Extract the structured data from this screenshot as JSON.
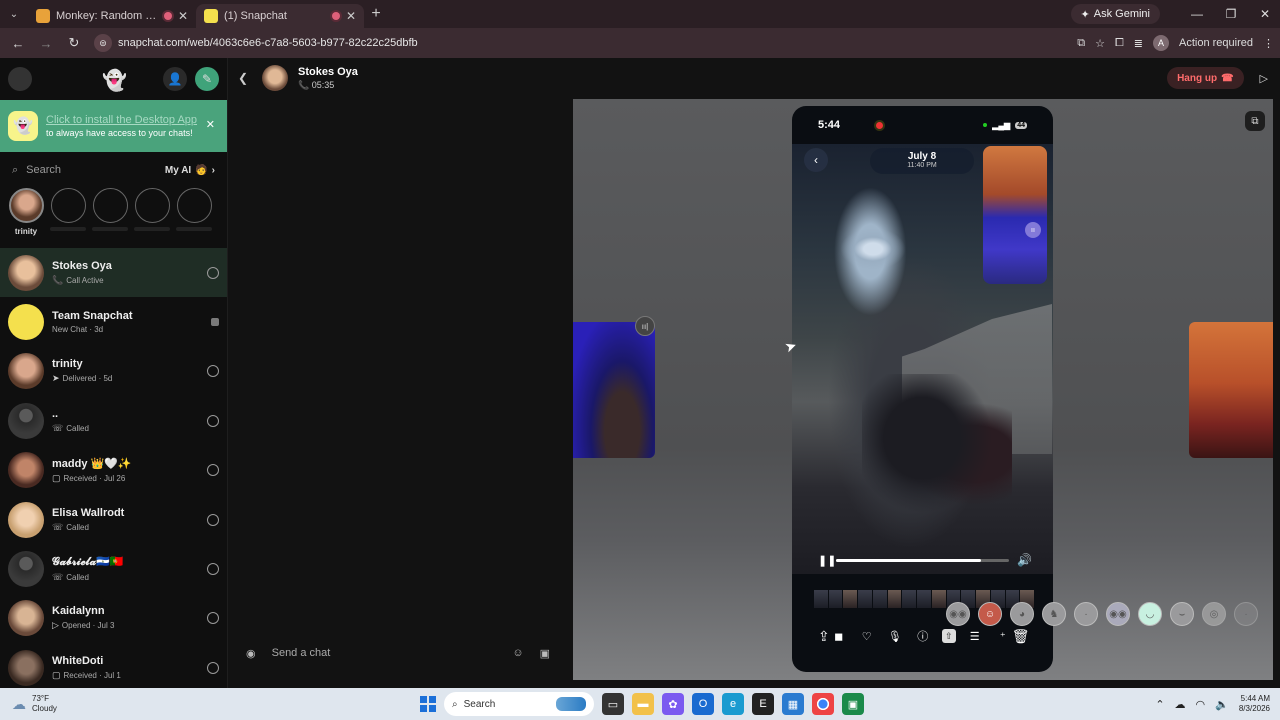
{
  "browser": {
    "tabs": [
      {
        "title": "Monkey: Random Video Ch",
        "fav_color": "#e8a23a",
        "active": false
      },
      {
        "title": "(1) Snapchat",
        "fav_color": "#f4e04d",
        "active": true
      }
    ],
    "ask_gemini": "Ask Gemini",
    "url": "snapchat.com/web/4063c6e6-c7a8-5603-b977-82c22c25dbfb",
    "action_required": "Action required",
    "profile_initial": "A"
  },
  "sidebar": {
    "install": {
      "title": "Click to install the Desktop App",
      "subtitle": "to always have access to your chats!"
    },
    "search_placeholder": "Search",
    "my_ai": "My AI",
    "stories": [
      {
        "name": "trinity",
        "has_image": true
      },
      {
        "name": "",
        "has_image": false
      },
      {
        "name": "",
        "has_image": false
      },
      {
        "name": "",
        "has_image": false
      },
      {
        "name": "",
        "has_image": false
      }
    ],
    "chats": [
      {
        "name": "Stokes Oya",
        "status_icon": "📞",
        "status": "Call Active",
        "av": "#c89b7b"
      },
      {
        "name": "Team Snapchat",
        "status_icon": "",
        "status": "New Chat · 3d",
        "av": "#f4e04d"
      },
      {
        "name": "trinity",
        "status_icon": "➤",
        "status": "Delivered · 5d",
        "av": "#b88a70"
      },
      {
        "name": "..",
        "status_icon": "☏",
        "status": "Called",
        "av": "#4a4a4a"
      },
      {
        "name": "maddy 👑🤍✨",
        "status_icon": "▢",
        "status": "Received · Jul 26",
        "av": "#8a5a4a"
      },
      {
        "name": "Elisa Wallrodt",
        "status_icon": "☏",
        "status": "Called",
        "av": "#d6b48a"
      },
      {
        "name": "𝓖𝓪𝓫𝓻𝓲𝓮𝓵𝓪🇸🇻🇵🇹",
        "status_icon": "☏",
        "status": "Called",
        "av": "#4a4a4a"
      },
      {
        "name": "Kaidalynn",
        "status_icon": "▷",
        "status": "Opened · Jul 3",
        "av": "#a9806a"
      },
      {
        "name": "WhiteDoti",
        "status_icon": "▢",
        "status": "Received · Jul 1",
        "av": "#6a5a52"
      }
    ]
  },
  "chat": {
    "contact": "Stokes Oya",
    "duration": "05:35",
    "compose_placeholder": "Send a chat"
  },
  "call": {
    "hang_up": "Hang up",
    "phone": {
      "time": "5:44",
      "battery": "44",
      "date": "July 8",
      "date_time": "11:40 PM",
      "progress": 0.84
    },
    "lens_count": 10
  },
  "taskbar": {
    "temp": "73°F",
    "weather": "Cloudy",
    "search_label": "Search",
    "time": "5:44 AM",
    "date": "8/3/2026"
  }
}
